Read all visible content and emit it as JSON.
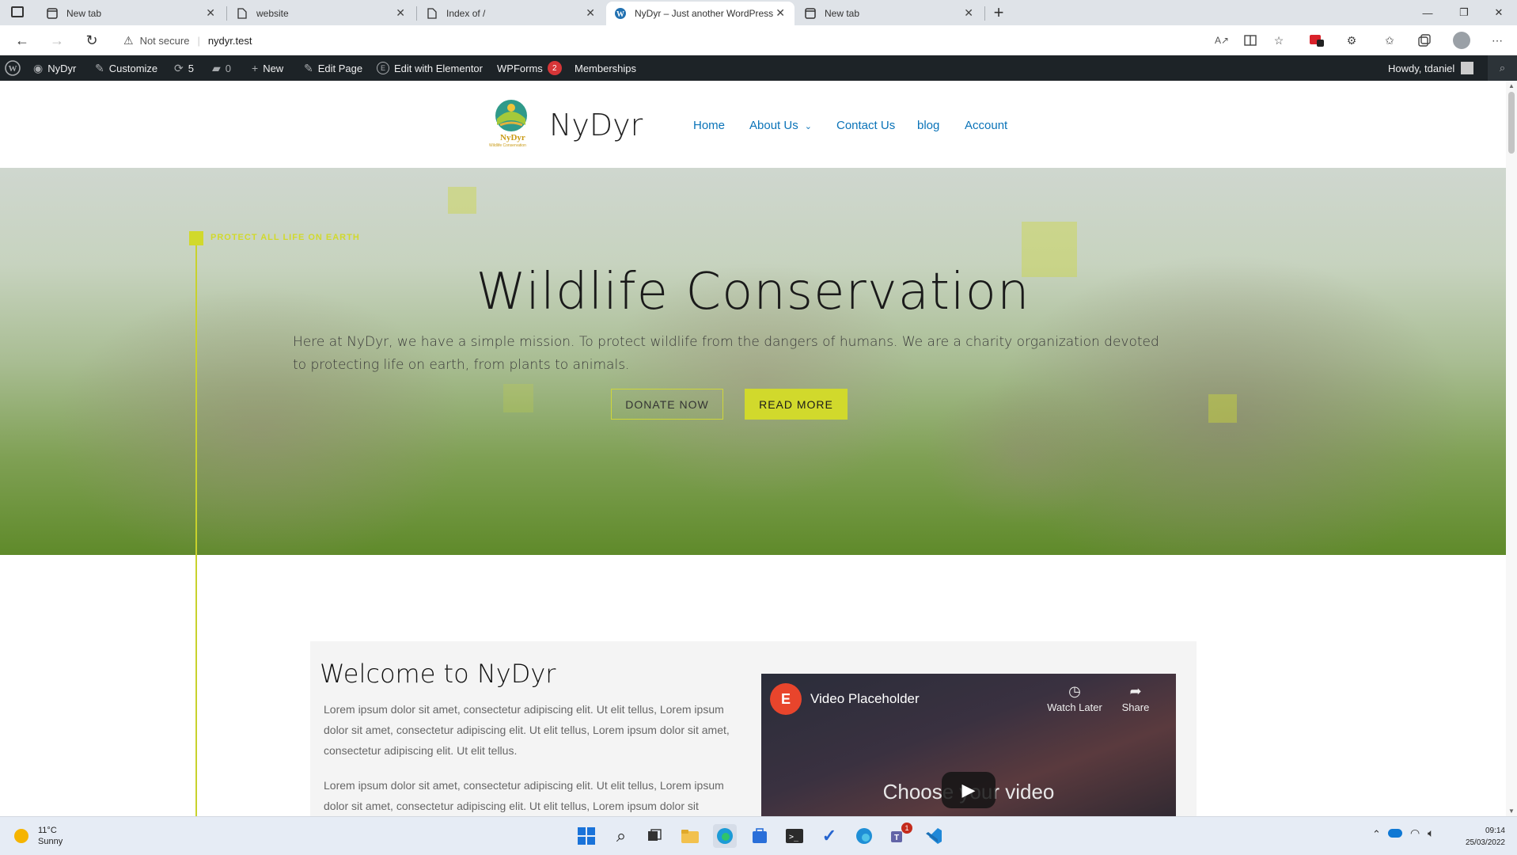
{
  "browser": {
    "tabs": [
      {
        "title": "New tab",
        "icon": "new-tab-icon"
      },
      {
        "title": "website",
        "icon": "page-icon"
      },
      {
        "title": "Index of /",
        "icon": "page-icon"
      },
      {
        "title": "NyDyr – Just another WordPress",
        "icon": "wordpress-icon",
        "active": true
      },
      {
        "title": "New tab",
        "icon": "new-tab-icon"
      }
    ],
    "security_label": "Not secure",
    "url": "nydyr.test"
  },
  "adminbar": {
    "site_name": "NyDyr",
    "customize": "Customize",
    "updates_count": "5",
    "comments_count": "0",
    "new": "New",
    "edit_page": "Edit Page",
    "edit_elementor": "Edit with Elementor",
    "wpforms": "WPForms",
    "wpforms_badge": "2",
    "memberships": "Memberships",
    "howdy": "Howdy, tdaniel"
  },
  "header": {
    "logo_text": "NyDyr",
    "logo_subtext": "Wildlife Conservation",
    "site_title": "NyDyr",
    "menu": [
      "Home",
      "About Us",
      "Contact Us",
      "blog",
      "Account"
    ]
  },
  "hero": {
    "tagline": "PROTECT ALL LIFE ON EARTH",
    "title": "Wildlife Conservation",
    "description": "Here at NyDyr, we have a simple mission. To protect wildlife from the dangers of humans. We are a charity organization devoted to protecting life on earth, from plants to animals.",
    "donate_label": "DONATE NOW",
    "readmore_label": "READ MORE",
    "accent_color": "#d1d92c"
  },
  "welcome": {
    "title": "Welcome to NyDyr",
    "para1": "Lorem ipsum dolor sit amet, consectetur adipiscing elit. Ut elit tellus, Lorem ipsum dolor sit amet, consectetur adipiscing elit. Ut elit tellus, Lorem ipsum dolor sit amet, consectetur adipiscing elit. Ut elit tellus.",
    "para2": "Lorem ipsum dolor sit amet, consectetur adipiscing elit. Ut elit tellus, Lorem ipsum dolor sit amet, consectetur adipiscing elit. Ut elit tellus, Lorem ipsum dolor sit",
    "video": {
      "title": "Video Placeholder",
      "watch_later": "Watch Later",
      "share": "Share",
      "caption": "Choose your video"
    }
  },
  "taskbar": {
    "weather_temp": "11°C",
    "weather_desc": "Sunny",
    "time": "09:14",
    "date": "25/03/2022",
    "teams_badge": "1"
  }
}
